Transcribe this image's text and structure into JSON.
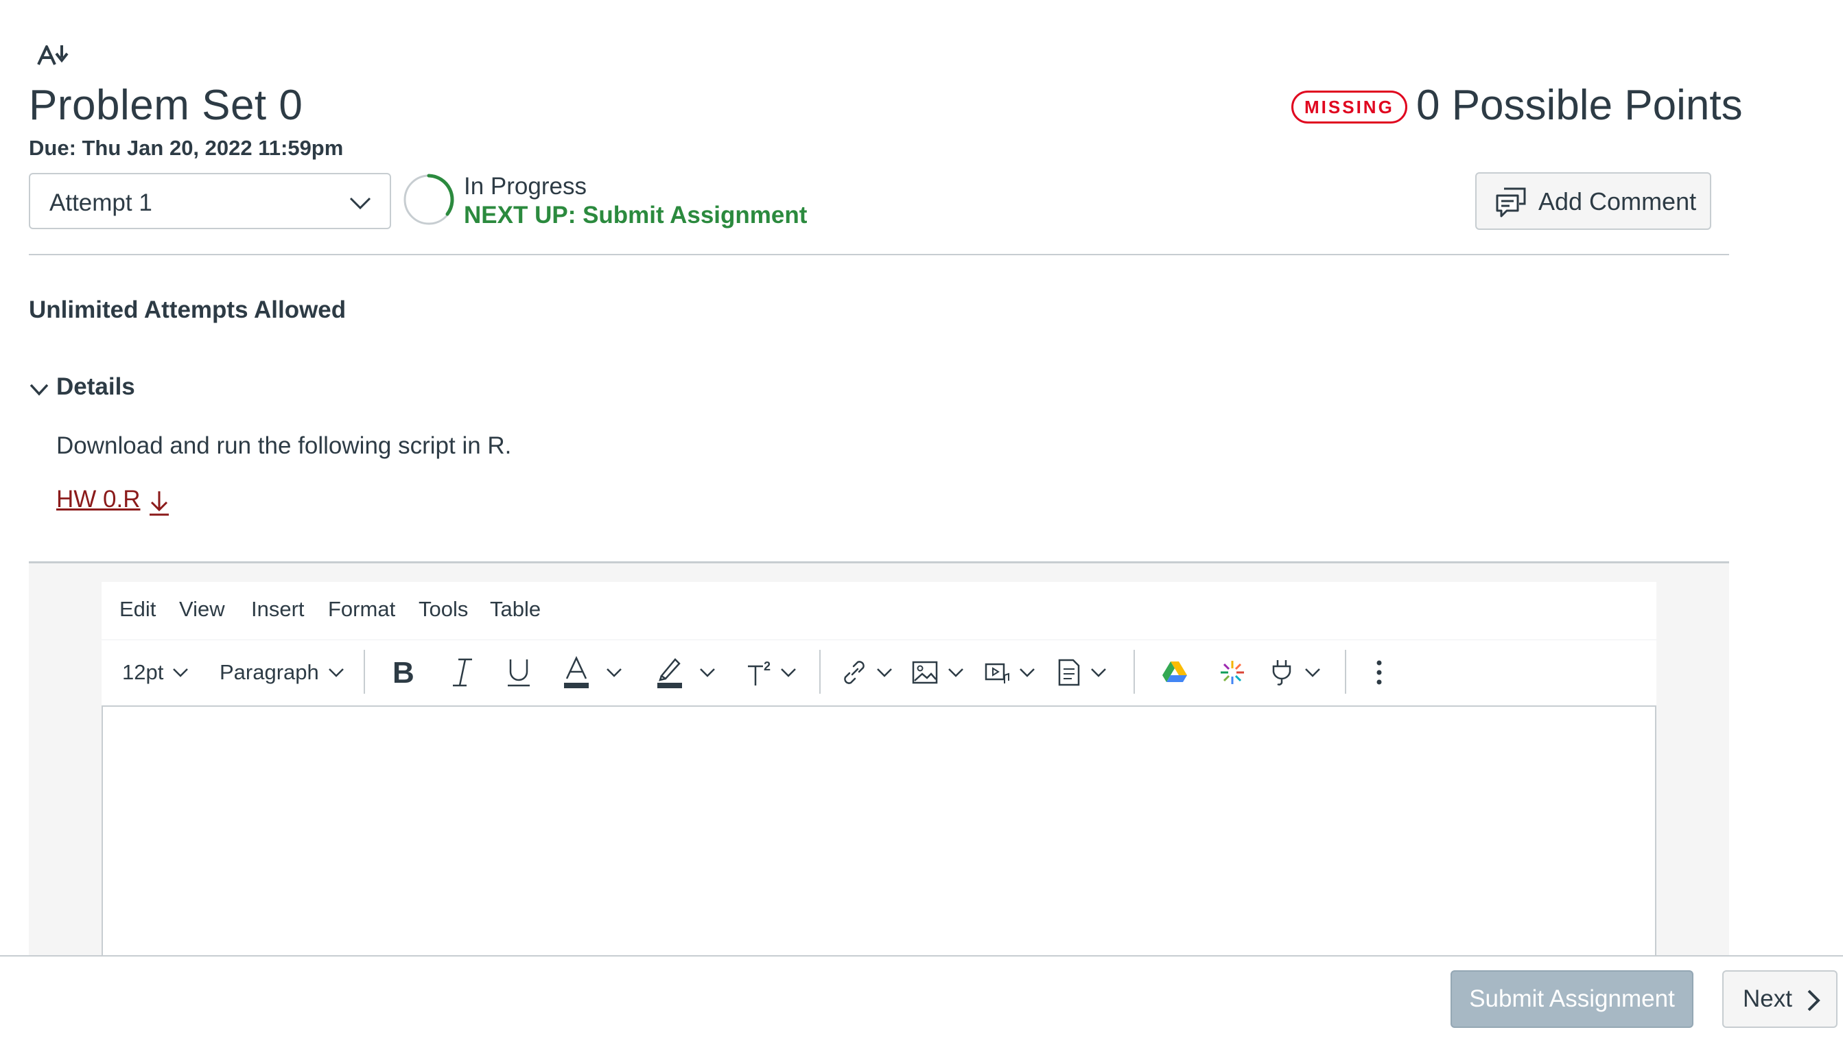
{
  "header": {
    "title": "Problem Set 0",
    "due": "Due: Thu Jan 20, 2022 11:59pm",
    "missing_badge": "MISSING",
    "points": "0 Possible Points"
  },
  "attempt": {
    "selected": "Attempt 1",
    "status": "In Progress",
    "next_up": "NEXT UP: Submit Assignment",
    "add_comment": "Add Comment"
  },
  "info": {
    "attempts_allowed": "Unlimited Attempts Allowed",
    "details_label": "Details",
    "description": "Download and run the following script in R.",
    "file_link": "HW 0.R"
  },
  "editor": {
    "menu": [
      "Edit",
      "View",
      "Insert",
      "Format",
      "Tools",
      "Table"
    ],
    "font_size": "12pt",
    "block_format": "Paragraph",
    "toolbar_icons": [
      "bold-icon",
      "italic-icon",
      "underline-icon",
      "text-color-icon",
      "highlight-icon",
      "superscript-icon",
      "link-icon",
      "image-icon",
      "media-icon",
      "document-icon",
      "google-drive-icon",
      "apps-icon",
      "plugin-icon",
      "more-icon"
    ]
  },
  "footer": {
    "submit": "Submit Assignment",
    "next": "Next"
  },
  "colors": {
    "missing": "#E0061F",
    "next_up": "#2B8A3E",
    "link": "#8B1A1A",
    "submit_disabled": "#A7B8C4"
  }
}
